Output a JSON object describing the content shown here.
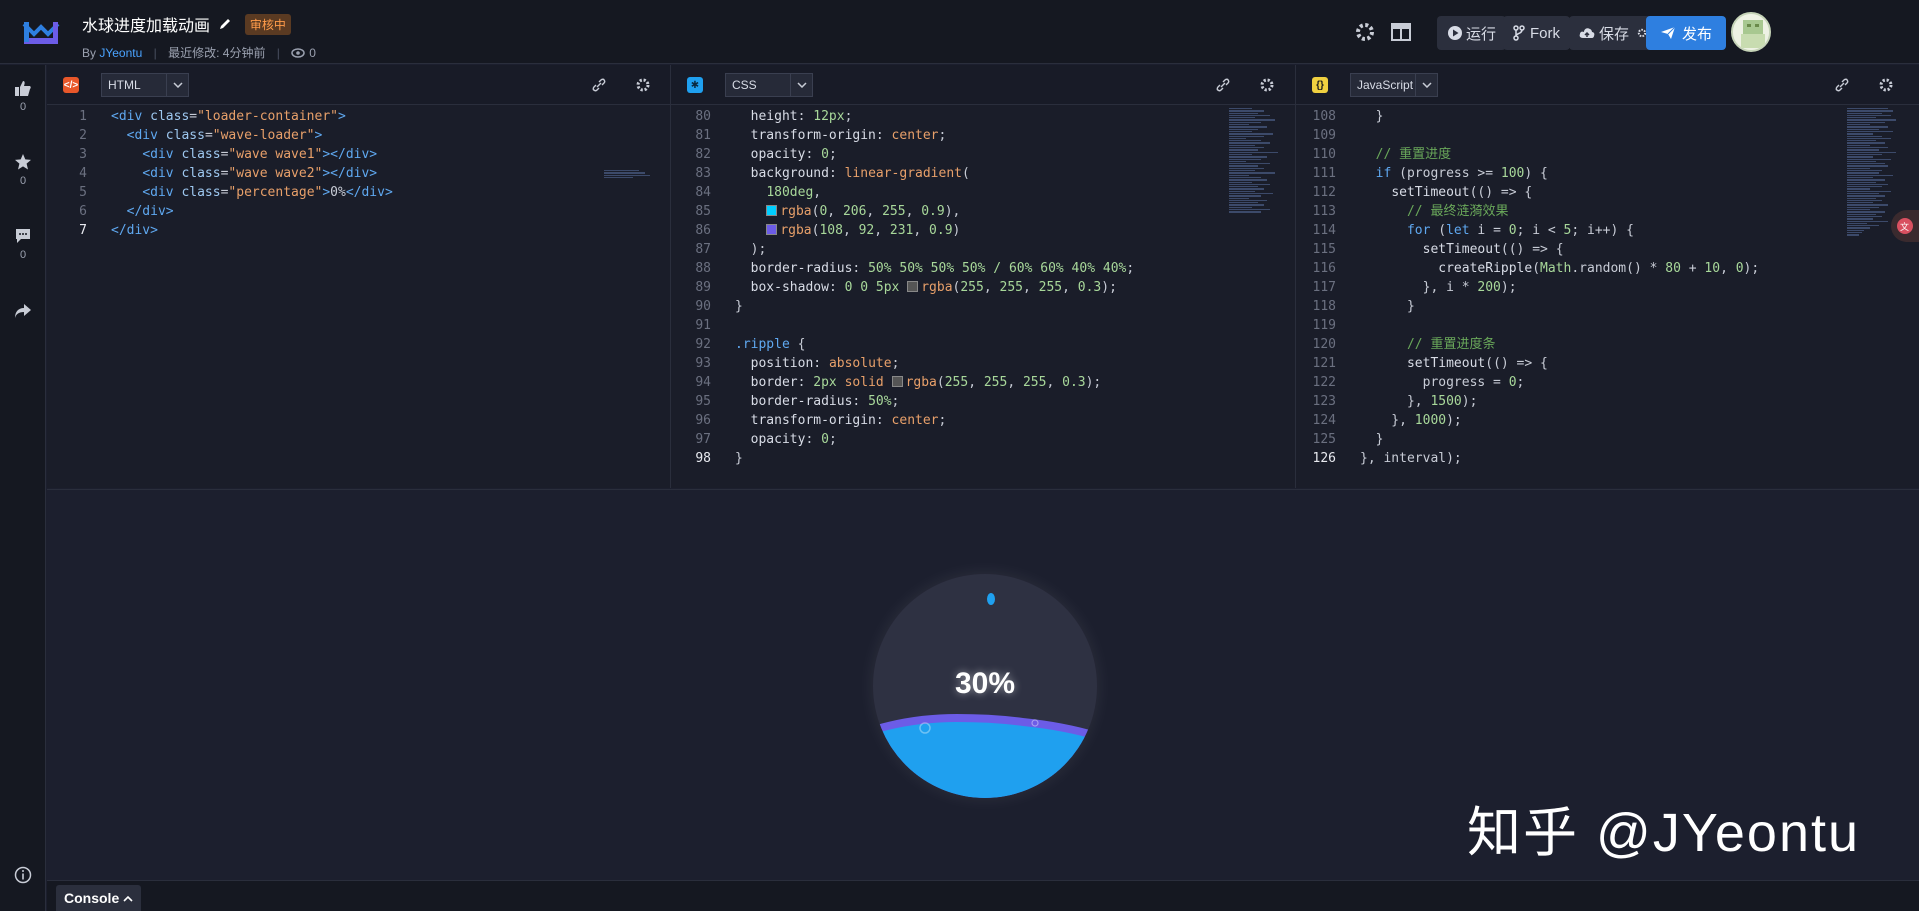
{
  "app": {
    "title": "水球进度加载动画",
    "status_badge": "审核中",
    "by_label": "By",
    "author": "JYeontu",
    "modified": "最近修改: 4分钟前",
    "views": "0"
  },
  "toolbar": {
    "run_label": "运行",
    "fork_label": "Fork",
    "save_label": "保存",
    "publish_label": "发布"
  },
  "rail": {
    "likes": "0",
    "stars": "0",
    "comments": "0"
  },
  "panes": {
    "html": {
      "lang": "HTML"
    },
    "css": {
      "lang": "CSS"
    },
    "js": {
      "lang": "JavaScript"
    }
  },
  "preview": {
    "percent": "30%",
    "watermark": "知乎 @JYeontu"
  },
  "console": {
    "label": "Console"
  },
  "colors": {
    "bg": "#1c1f2e",
    "accent": "#2e7fe0",
    "wave_cyan": "#1fa0ef",
    "wave_purple": "#6c5ce7",
    "badge": "#ff9b4a"
  }
}
